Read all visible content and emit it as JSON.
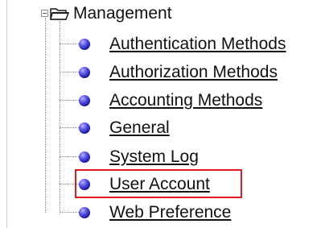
{
  "tree": {
    "root_label": "Management",
    "items": [
      {
        "label": "Authentication Methods"
      },
      {
        "label": "Authorization Methods"
      },
      {
        "label": "Accounting Methods"
      },
      {
        "label": "General"
      },
      {
        "label": "System Log"
      },
      {
        "label": "User Account",
        "highlighted": true
      },
      {
        "label": "Web Preference"
      }
    ]
  },
  "colors": {
    "highlight_border": "#e01a20",
    "bullet": "#2b28c9"
  }
}
